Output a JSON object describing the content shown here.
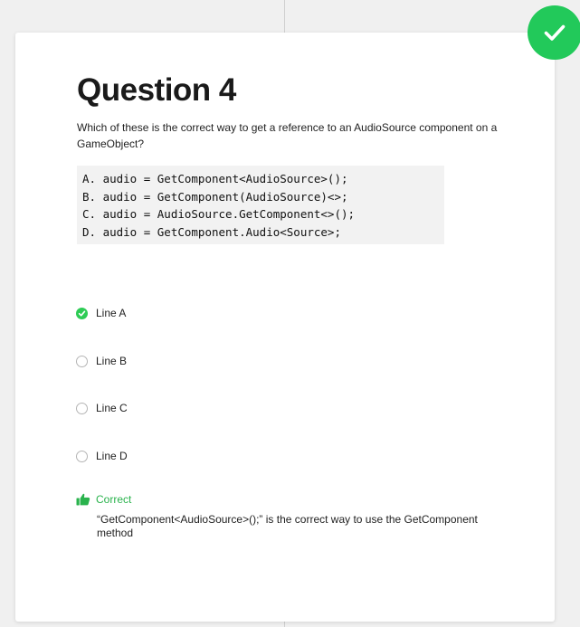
{
  "question": {
    "title": "Question 4",
    "prompt": "Which of these is the correct way to get a reference to an AudioSource component on a GameObject?",
    "code_lines": [
      "A. audio = GetComponent<AudioSource>();",
      "B. audio = GetComponent(AudioSource)<>;",
      "C. audio = AudioSource.GetComponent<>();",
      "D. audio = GetComponent.Audio<Source>;"
    ]
  },
  "options": [
    {
      "label": "Line A",
      "selected": true
    },
    {
      "label": "Line B",
      "selected": false
    },
    {
      "label": "Line C",
      "selected": false
    },
    {
      "label": "Line D",
      "selected": false
    }
  ],
  "feedback": {
    "title": "Correct",
    "text": "“GetComponent<AudioSource>();” is the correct way to use the GetComponent method",
    "icon": "thumbs-up-icon"
  },
  "badge": {
    "icon": "checkmark-icon",
    "color": "#22c95a"
  },
  "colors": {
    "accent": "#2ecc55",
    "feedback": "#2ab34d",
    "code_background": "#f2f2f2"
  }
}
